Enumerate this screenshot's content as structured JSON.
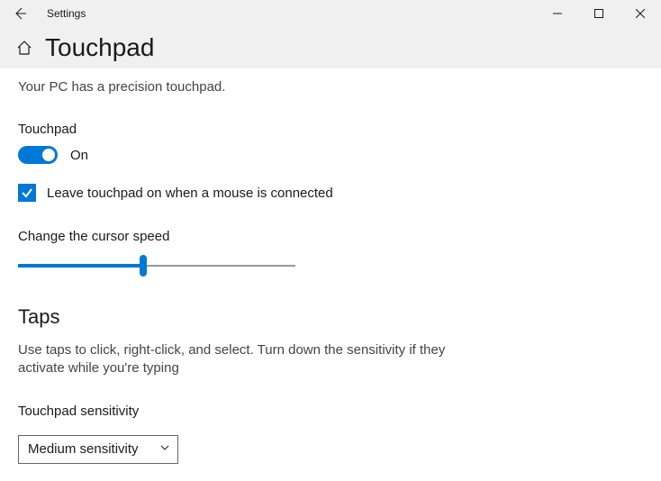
{
  "window": {
    "title": "Settings"
  },
  "header": {
    "page_title": "Touchpad"
  },
  "main": {
    "intro": "Your PC has a precision touchpad.",
    "touchpad_label": "Touchpad",
    "toggle_state_label": "On",
    "mouse_checkbox_label": "Leave touchpad on when a mouse is connected",
    "cursor_speed_label": "Change the cursor speed",
    "cursor_speed_percent": 45,
    "taps_heading": "Taps",
    "taps_description": "Use taps to click, right-click, and select. Turn down the sensitivity if they activate while you're typing",
    "sensitivity_label": "Touchpad sensitivity",
    "sensitivity_value": "Medium sensitivity"
  }
}
